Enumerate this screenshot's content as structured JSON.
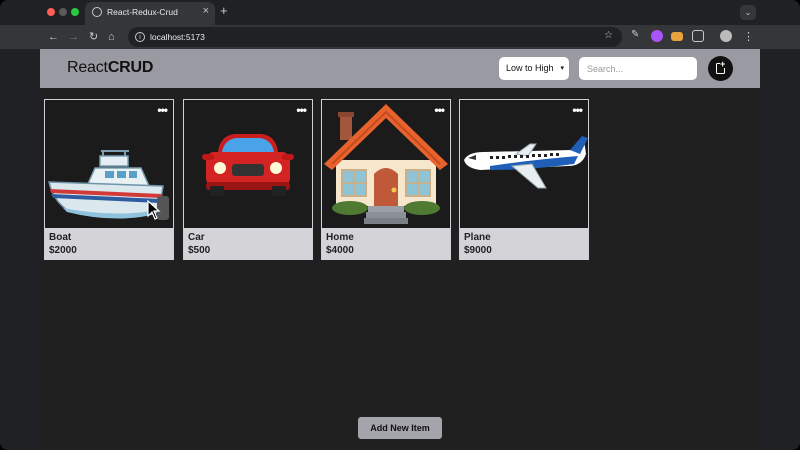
{
  "browser": {
    "tab_title": "React-Redux-Crud",
    "url": "localhost:5173",
    "new_tab": "+",
    "tab_close": "×"
  },
  "app": {
    "logo_light": "React",
    "logo_bold": "CRUD",
    "sort_selected": "Low to High",
    "search_placeholder": "Search...",
    "add_button_label": "Add New Item"
  },
  "items": [
    {
      "name": "Boat",
      "price": "$2000",
      "menu": "•••"
    },
    {
      "name": "Car",
      "price": "$500",
      "menu": "•••"
    },
    {
      "name": "Home",
      "price": "$4000",
      "menu": "•••"
    },
    {
      "name": "Plane",
      "price": "$9000",
      "menu": "•••"
    }
  ],
  "colors": {
    "header_bg": "#9a9aa2",
    "page_bg": "#202020",
    "card_info_bg": "#d4d4d8"
  }
}
